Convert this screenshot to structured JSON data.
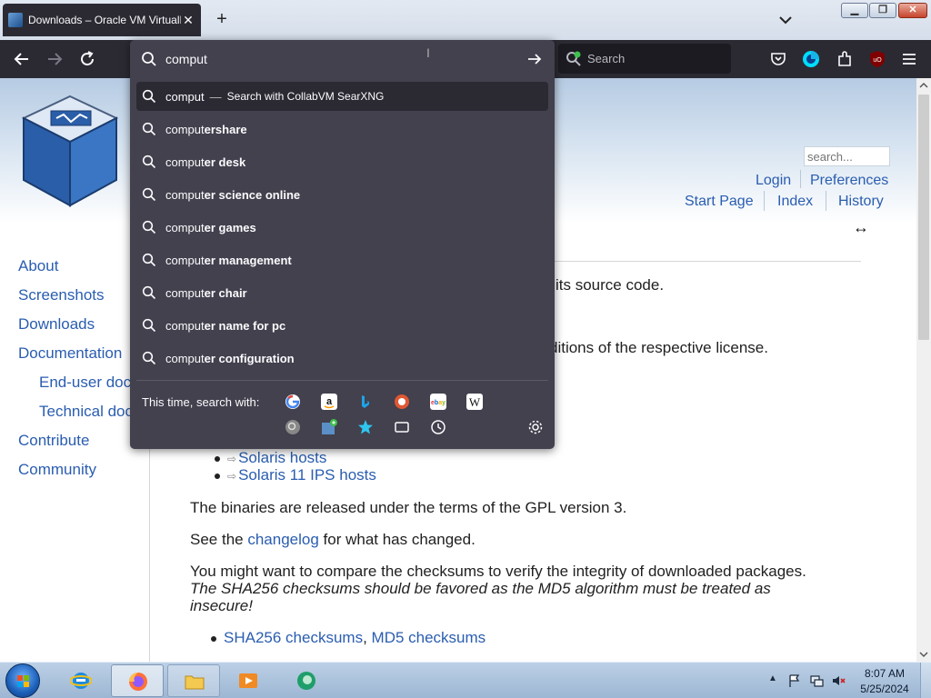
{
  "browser": {
    "tab_title": "Downloads – Oracle VM VirtualBox",
    "tab_close": "✕",
    "new_tab": "+",
    "search_placeholder": "Search"
  },
  "window_controls": {
    "close": "✕"
  },
  "urlbar": {
    "value": "comput",
    "suggestions": [
      {
        "typed": "comput",
        "rest": "",
        "engine_text": "Search with CollabVM SearXNG",
        "selected": true
      },
      {
        "typed": "comput",
        "rest": "ershare"
      },
      {
        "typed": "comput",
        "rest": "er desk"
      },
      {
        "typed": "comput",
        "rest": "er science online"
      },
      {
        "typed": "comput",
        "rest": "er games"
      },
      {
        "typed": "comput",
        "rest": "er management"
      },
      {
        "typed": "comput",
        "rest": "er chair"
      },
      {
        "typed": "comput",
        "rest": "er name for pc"
      },
      {
        "typed": "comput",
        "rest": "er configuration"
      }
    ],
    "dash": "—",
    "oneoff_label": "This time, search with:",
    "engines": [
      "google",
      "amazon",
      "bing",
      "duckduckgo",
      "ebay",
      "wikipedia",
      "searx",
      "collabvm",
      "bookmarks",
      "tabs",
      "history",
      "settings"
    ]
  },
  "page": {
    "search_placeholder": "search...",
    "links": {
      "login": "Login",
      "preferences": "Preferences",
      "start_page": "Start Page",
      "index": "Index",
      "history": "History"
    },
    "resize_arrow": "↔",
    "sidebar": [
      "About",
      "Screenshots",
      "Downloads",
      "Documentation",
      "End-user docs",
      "Technical docs",
      "Contribute",
      "Community"
    ],
    "frag1": "its source code.",
    "frag2": "ditions of the respective license.",
    "solaris": "Solaris hosts",
    "solaris11": "Solaris 11 IPS hosts",
    "gpl": "The binaries are released under the terms of the GPL version 3.",
    "changelog_pre": "See the ",
    "changelog_link": "changelog",
    "changelog_post": " for what has changed.",
    "compare": "You might want to compare the checksums to verify the integrity of downloaded packages.",
    "sha_note": "The SHA256 checksums should be favored as the MD5 algorithm must be treated as",
    "insecure": "insecure!",
    "sha_link": "SHA256 checksums",
    "comma": ", ",
    "md5_link": "MD5 checksums",
    "ext_glyph": "⇨"
  },
  "taskbar": {
    "time": "8:07 AM",
    "date": "5/25/2024",
    "tray_up": "▲"
  },
  "colors": {
    "browser_dark": "#2b2a33",
    "dropdown": "#42414d",
    "link": "#2a5db0",
    "firefox_accent": "#00ddff"
  }
}
